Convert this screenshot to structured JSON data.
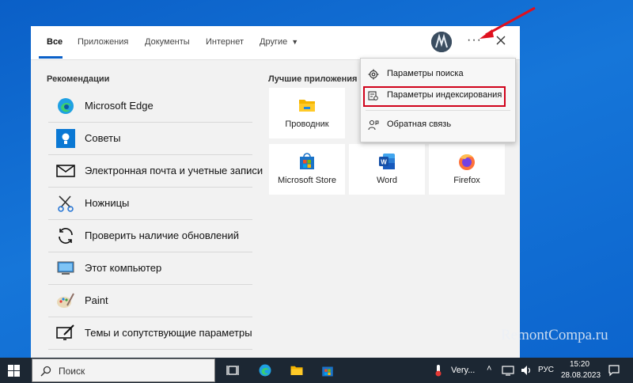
{
  "tabs": [
    {
      "label": "Все"
    },
    {
      "label": "Приложения"
    },
    {
      "label": "Документы"
    },
    {
      "label": "Интернет"
    },
    {
      "label": "Другие"
    }
  ],
  "recommendations": {
    "title": "Рекомендации",
    "items": [
      {
        "label": "Microsoft Edge",
        "icon": "edge-icon"
      },
      {
        "label": "Советы",
        "icon": "tips-icon"
      },
      {
        "label": "Электронная почта и учетные записи",
        "icon": "mail-icon"
      },
      {
        "label": "Ножницы",
        "icon": "snipping-icon"
      },
      {
        "label": "Проверить наличие обновлений",
        "icon": "update-icon"
      },
      {
        "label": "Этот компьютер",
        "icon": "computer-icon"
      },
      {
        "label": "Paint",
        "icon": "paint-icon"
      },
      {
        "label": "Темы и сопутствующие параметры",
        "icon": "themes-icon"
      }
    ]
  },
  "top_apps": {
    "title": "Лучшие приложения",
    "items": [
      {
        "label": "Проводник",
        "icon": "explorer-icon"
      },
      {
        "label": "Microsoft Store",
        "icon": "store-icon"
      },
      {
        "label": "Word",
        "icon": "word-icon"
      },
      {
        "label": "Firefox",
        "icon": "firefox-icon"
      }
    ]
  },
  "menu": {
    "items": [
      {
        "label": "Параметры поиска",
        "icon": "gear-icon"
      },
      {
        "label": "Параметры индексирования",
        "icon": "indexing-icon",
        "highlighted": true
      },
      {
        "label": "Обратная связь",
        "icon": "feedback-icon"
      }
    ]
  },
  "taskbar": {
    "search_placeholder": "Поиск",
    "weather": "Very...",
    "language": "РУС",
    "time": "15:20",
    "date": "28.08.2023"
  },
  "watermark": "RemontCompa.ru",
  "colors": {
    "accent": "#0a60c8",
    "highlight_border": "#d0021b",
    "arrow": "#e0101e"
  }
}
